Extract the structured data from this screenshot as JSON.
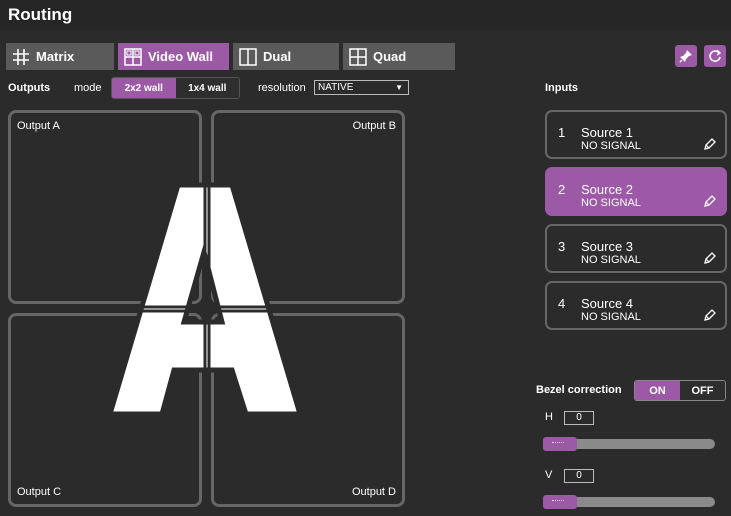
{
  "app": {
    "title": "Routing"
  },
  "tabs": [
    {
      "label": "Matrix",
      "icon": "matrix-icon"
    },
    {
      "label": "Video Wall",
      "icon": "video-wall-icon",
      "active": true
    },
    {
      "label": "Dual",
      "icon": "dual-icon"
    },
    {
      "label": "Quad",
      "icon": "quad-icon"
    }
  ],
  "toolbar": {
    "pin_icon": "pin-icon",
    "refresh_icon": "refresh-icon"
  },
  "outputs": {
    "heading": "Outputs",
    "mode_label": "mode",
    "modes": [
      "2x2 wall",
      "1x4 wall"
    ],
    "selected_mode": "2x2 wall",
    "resolution_label": "resolution",
    "resolution_value": "NATIVE",
    "panels": [
      "Output A",
      "Output B",
      "Output C",
      "Output D"
    ],
    "wall_letter": "A"
  },
  "inputs": {
    "heading": "Inputs",
    "items": [
      {
        "num": "1",
        "name": "Source 1",
        "signal": "NO SIGNAL"
      },
      {
        "num": "2",
        "name": "Source 2",
        "signal": "NO SIGNAL",
        "active": true
      },
      {
        "num": "3",
        "name": "Source 3",
        "signal": "NO SIGNAL"
      },
      {
        "num": "4",
        "name": "Source 4",
        "signal": "NO SIGNAL"
      }
    ]
  },
  "bezel": {
    "label": "Bezel correction",
    "on_label": "ON",
    "off_label": "OFF",
    "state": "ON",
    "h_label": "H",
    "h_value": "0",
    "v_label": "V",
    "v_value": "0"
  },
  "colors": {
    "accent": "#9b59a6",
    "background": "#2b2b2b",
    "tab": "#5a5a5a",
    "border": "#666666"
  }
}
